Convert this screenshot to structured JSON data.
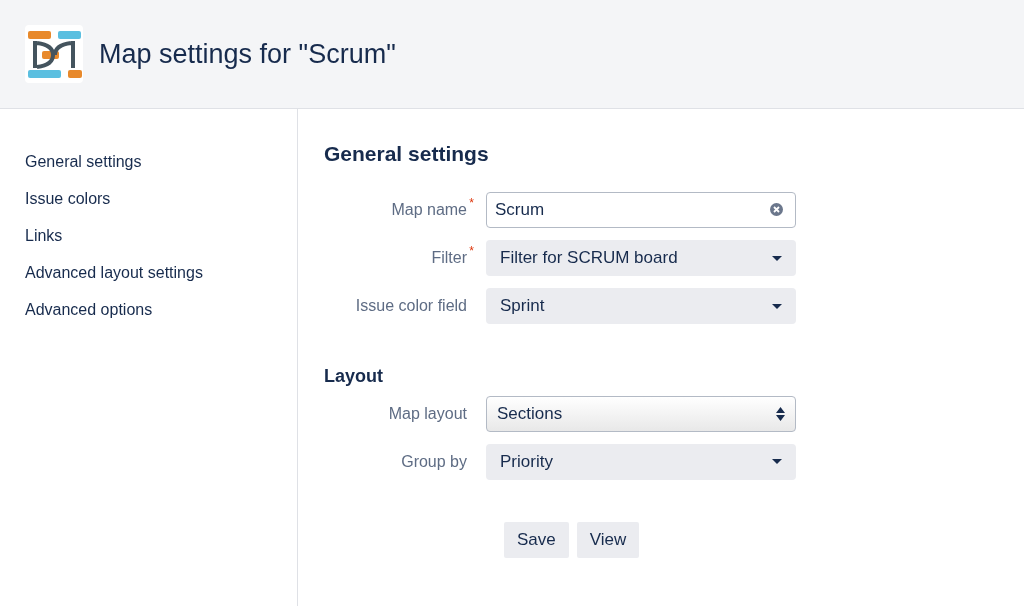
{
  "header": {
    "title": "Map settings for \"Scrum\""
  },
  "sidebar": {
    "items": [
      {
        "label": "General settings"
      },
      {
        "label": "Issue colors"
      },
      {
        "label": "Links"
      },
      {
        "label": "Advanced layout settings"
      },
      {
        "label": "Advanced options"
      }
    ]
  },
  "sections": [
    {
      "title": "General settings",
      "fields": [
        {
          "label": "Map name",
          "required_mark": "*",
          "kind": "text",
          "value": "Scrum"
        },
        {
          "label": "Filter",
          "required_mark": "*",
          "kind": "dropdown",
          "value": "Filter for SCRUM board"
        },
        {
          "label": "Issue color field",
          "kind": "dropdown",
          "value": "Sprint"
        }
      ]
    },
    {
      "title": "Layout",
      "fields": [
        {
          "label": "Map layout",
          "kind": "select",
          "value": "Sections"
        },
        {
          "label": "Group by",
          "kind": "dropdown",
          "value": "Priority"
        }
      ]
    }
  ],
  "buttons": [
    "Save",
    "View"
  ]
}
